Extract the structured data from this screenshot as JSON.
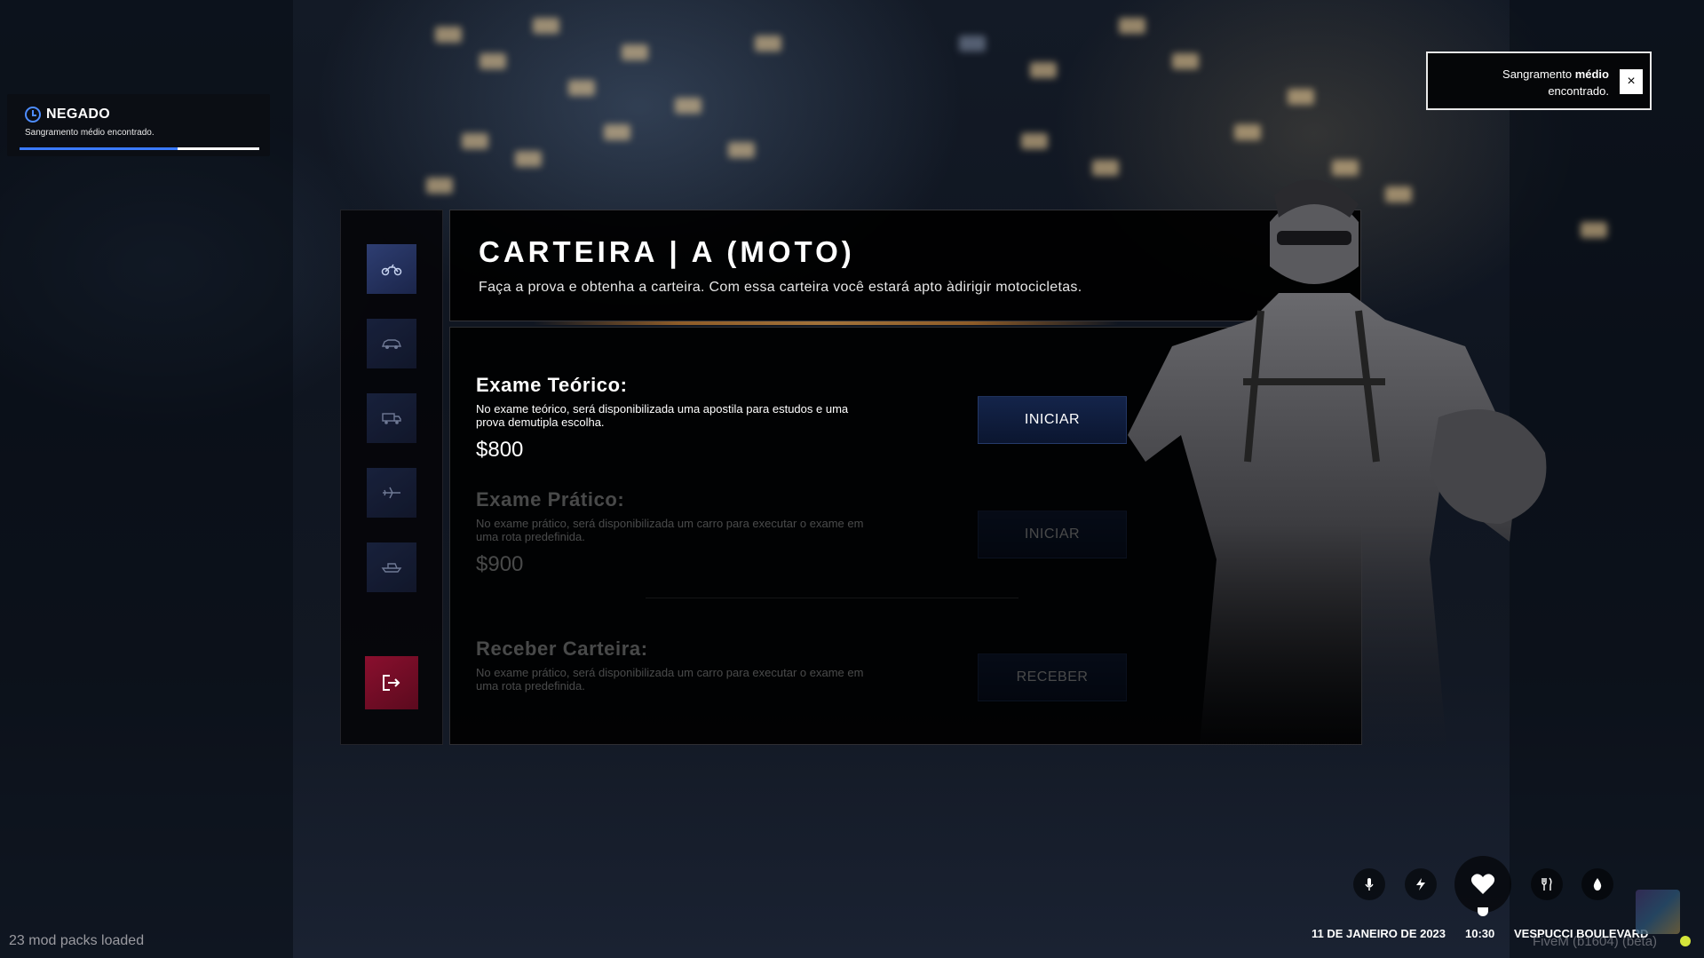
{
  "notification_left": {
    "title": "NEGADO",
    "message": "Sangramento médio encontrado.",
    "progress": 0.66,
    "accent_color": "#3b7bff",
    "icon": "clock-icon"
  },
  "notification_right": {
    "line1_prefix": "Sangramento ",
    "line1_bold": "médio",
    "line2": "encontrado.",
    "close_label": "×"
  },
  "sidebar": {
    "items": [
      {
        "icon": "motorcycle-icon",
        "active": true
      },
      {
        "icon": "car-icon",
        "active": false
      },
      {
        "icon": "truck-icon",
        "active": false
      },
      {
        "icon": "airplane-icon",
        "active": false
      },
      {
        "icon": "boat-icon",
        "active": false
      }
    ],
    "exit_icon": "exit-icon",
    "exit_color": "#8a0f2e"
  },
  "header": {
    "title": "CARTEIRA | A (MOTO)",
    "description": "Faça a prova e obtenha a carteira. Com essa carteira você estará apto àdirigir motocicletas."
  },
  "exams": {
    "theory": {
      "title": "Exame Teórico:",
      "description": "No exame teórico, será disponibilizada uma apostila para estudos e uma prova demutipla escolha.",
      "price": "$800",
      "button": "INICIAR"
    },
    "practical": {
      "title": "Exame Prático:",
      "description": "No exame prático, será disponibilizada um carro para executar o exame em uma rota predefinida.",
      "price": "$900",
      "button": "INICIAR"
    },
    "receive": {
      "title": "Receber Carteira:",
      "description": "No exame prático, será disponibilizada um carro para executar o exame em uma rota predefinida.",
      "button": "RECEBER"
    }
  },
  "hud": {
    "icons": [
      "microphone-icon",
      "lightning-icon",
      "heart-icon",
      "food-icon",
      "water-icon"
    ],
    "date": "11 DE JANEIRO DE 2023",
    "time": "10:30",
    "location": "VESPUCCI BOULEVARD"
  },
  "footer": {
    "mod_packs": "23 mod packs loaded",
    "fivem": "FiveM (b1604) (beta)"
  }
}
